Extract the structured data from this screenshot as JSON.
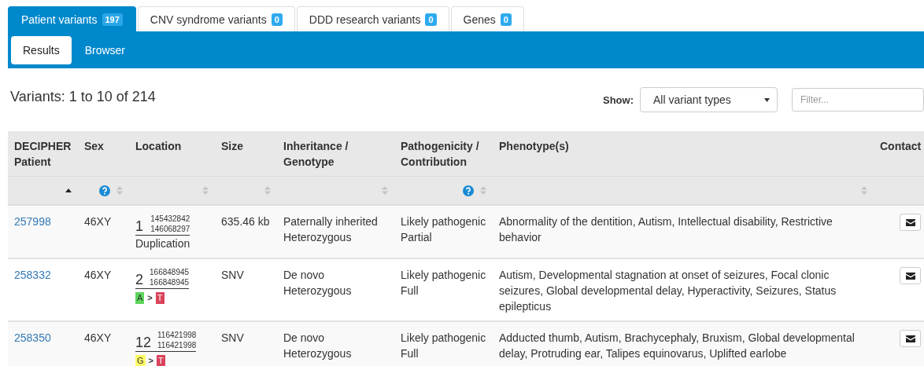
{
  "tabs": [
    {
      "label": "Patient variants",
      "count": "197",
      "selected": true
    },
    {
      "label": "CNV syndrome variants",
      "count": "0",
      "selected": false
    },
    {
      "label": "DDD research variants",
      "count": "0",
      "selected": false
    },
    {
      "label": "Genes",
      "count": "0",
      "selected": false
    }
  ],
  "subtabs": [
    {
      "label": "Results",
      "selected": true
    },
    {
      "label": "Browser",
      "selected": false
    }
  ],
  "summary": "Variants: 1 to 10 of 214",
  "show": {
    "label": "Show:",
    "value": "All variant types"
  },
  "filter": {
    "placeholder": "Filter..."
  },
  "columns": [
    {
      "label": "DECIPHER Patient",
      "sortable": true,
      "sorted": true,
      "help": false
    },
    {
      "label": "Sex",
      "sortable": true,
      "sorted": false,
      "help": true
    },
    {
      "label": "Location",
      "sortable": true,
      "sorted": false,
      "help": false
    },
    {
      "label": "Size",
      "sortable": true,
      "sorted": false,
      "help": false
    },
    {
      "label": "Inheritance / Genotype",
      "sortable": true,
      "sorted": false,
      "help": false
    },
    {
      "label": "Pathogenicity / Contribution",
      "sortable": true,
      "sorted": false,
      "help": true
    },
    {
      "label": "Phenotype(s)",
      "sortable": true,
      "sorted": false,
      "help": false
    },
    {
      "label": "Contact",
      "sortable": false,
      "help": false
    }
  ],
  "rows": [
    {
      "patient": "257998",
      "sex": "46XY",
      "location": {
        "kind": "cnv",
        "chromosome": "1",
        "start": "145432842",
        "end": "146068297",
        "type": "Duplication"
      },
      "size": "635.46 kb",
      "inheritance": [
        "Paternally inherited",
        "Heterozygous"
      ],
      "pathogenicity": [
        "Likely pathogenic",
        "Partial"
      ],
      "phenotypes": "Abnormality of the dentition, Autism, Intellectual disability, Restrictive behavior"
    },
    {
      "patient": "258332",
      "sex": "46XY",
      "location": {
        "kind": "snv",
        "chromosome": "2",
        "start": "166848945",
        "end": "166848945",
        "ref": {
          "base": "A",
          "color": "#5cd65c"
        },
        "arrow": ">",
        "alt": {
          "base": "T",
          "color": "#d9435a"
        }
      },
      "size": "SNV",
      "inheritance": [
        "De novo",
        "Heterozygous"
      ],
      "pathogenicity": [
        "Likely pathogenic",
        "Full"
      ],
      "phenotypes": "Autism, Developmental stagnation at onset of seizures, Focal clonic seizures, Global developmental delay, Hyperactivity, Seizures, Status epilepticus"
    },
    {
      "patient": "258350",
      "sex": "46XY",
      "location": {
        "kind": "snv",
        "chromosome": "12",
        "start": "116421998",
        "end": "116421998",
        "ref": {
          "base": "G",
          "color": "#ffff66"
        },
        "arrow": ">",
        "alt": {
          "base": "T",
          "color": "#d9435a"
        }
      },
      "size": "SNV",
      "inheritance": [
        "De novo",
        "Heterozygous"
      ],
      "pathogenicity": [
        "Likely pathogenic",
        "Full"
      ],
      "phenotypes": "Adducted thumb, Autism, Brachycephaly, Bruxism, Global developmental delay, Protruding ear, Talipes equinovarus, Uplifted earlobe"
    }
  ]
}
